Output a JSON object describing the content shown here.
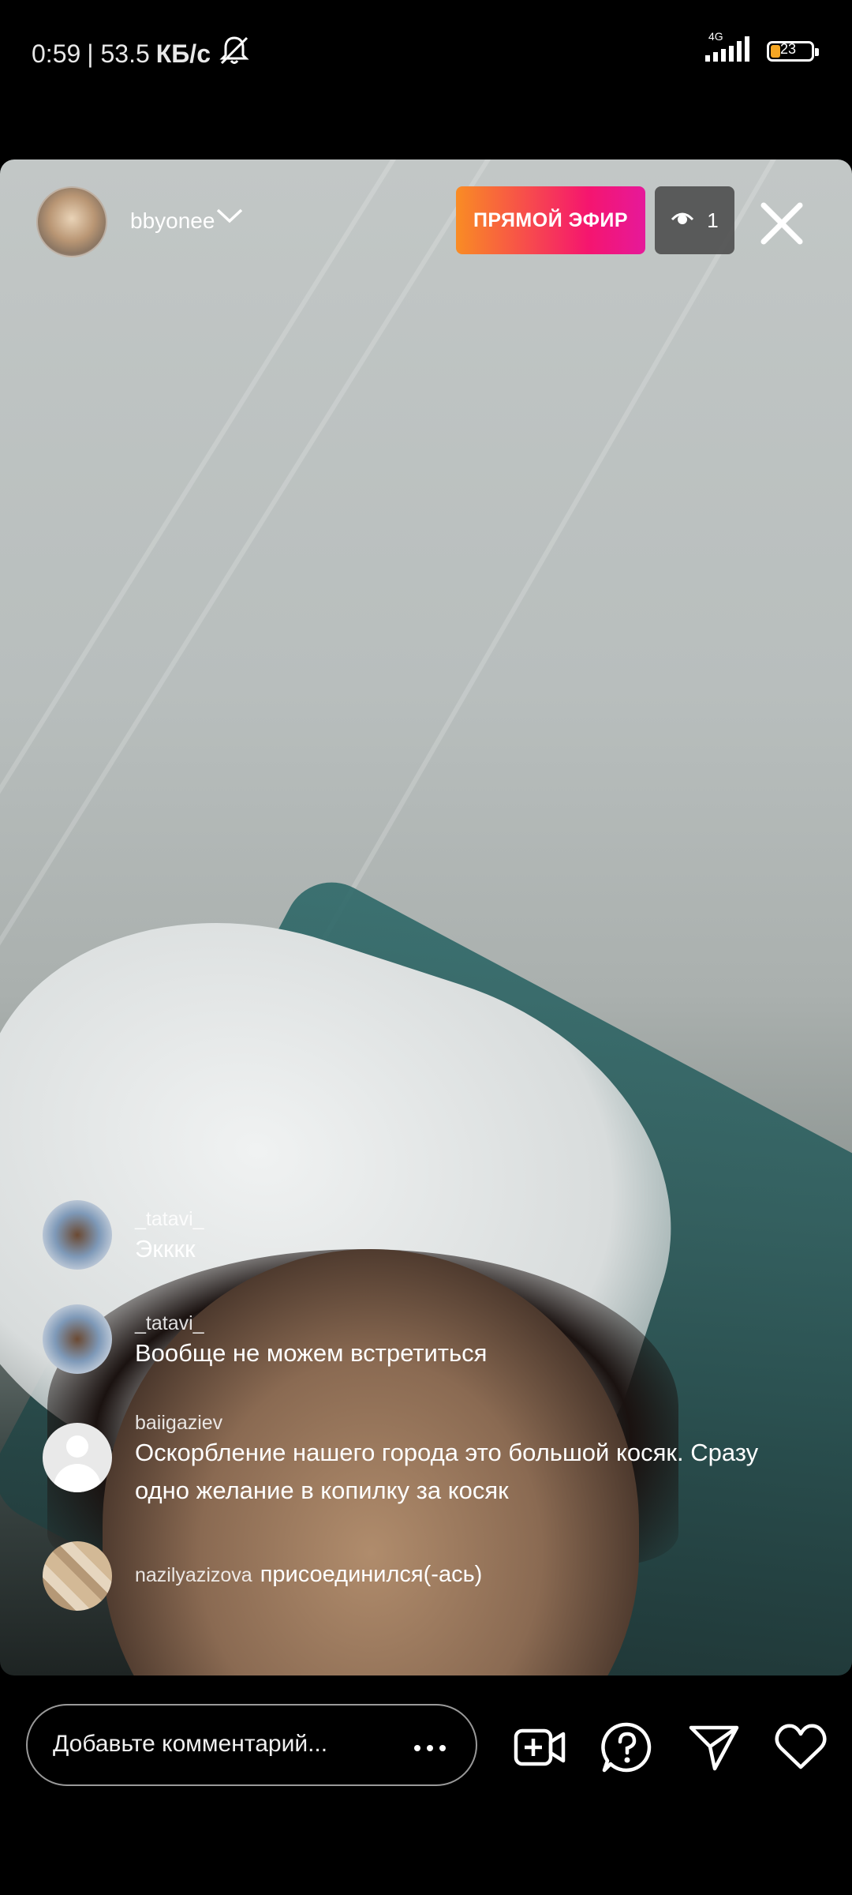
{
  "status_bar": {
    "time": "0:59",
    "speed": "| 53.5",
    "speed_unit": "КБ/с",
    "network": "4G",
    "battery": "23",
    "battery_level": 0.23
  },
  "live": {
    "host_username": "bbyonee",
    "badge": "ПРЯМОЙ ЭФИР",
    "viewer_count": "1"
  },
  "comments": [
    {
      "user": "_tatavi_",
      "text": "Экккк"
    },
    {
      "user": "_tatavi_",
      "text": "Вообще не можем встретиться"
    },
    {
      "user": "baiigaziev",
      "text": "Оскорбление нашего города это большой косяк. Сразу одно желание в копилку за косяк"
    }
  ],
  "joined": {
    "user": "nazilyazizova",
    "text": "присоединился(-ась)"
  },
  "bottom_bar": {
    "comment_placeholder": "Добавьте комментарий...",
    "icons": [
      "add-video-icon",
      "question-icon",
      "send-icon",
      "heart-icon"
    ]
  },
  "colors": {
    "live_gradient_start": "#f98c24",
    "live_gradient_end": "#e6199a",
    "battery_fill": "#f5a623"
  }
}
